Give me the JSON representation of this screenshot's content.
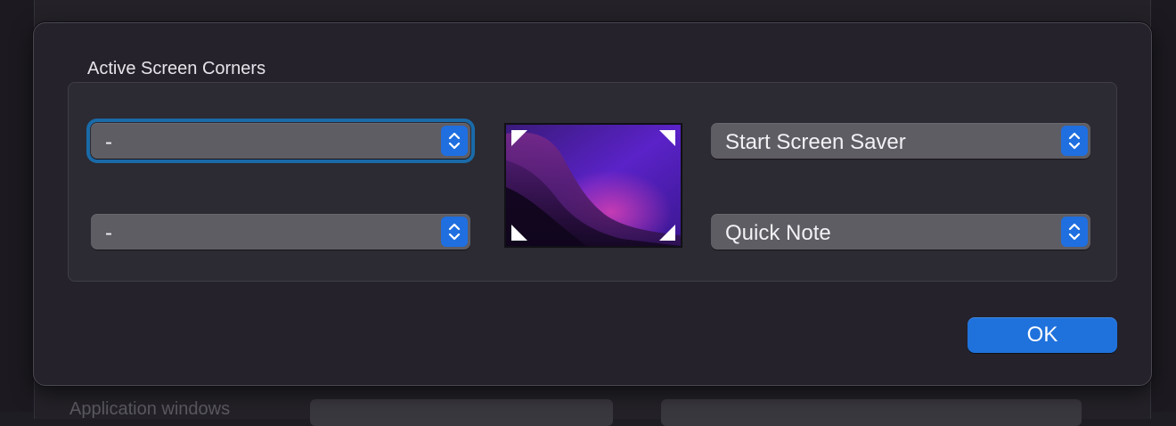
{
  "dialog": {
    "group_title": "Active Screen Corners",
    "ok_label": "OK"
  },
  "corners": {
    "top_left": "-",
    "bottom_left": "-",
    "top_right": "Start Screen Saver",
    "bottom_right": "Quick Note"
  },
  "background": {
    "label": "Application windows",
    "popup_a": "-",
    "popup_b": ""
  },
  "colors": {
    "accent": "#1f72dc",
    "focus_ring": "#1a6aa8",
    "sheet_bg": "#25222b",
    "popup_bg": "#5f5d64"
  }
}
